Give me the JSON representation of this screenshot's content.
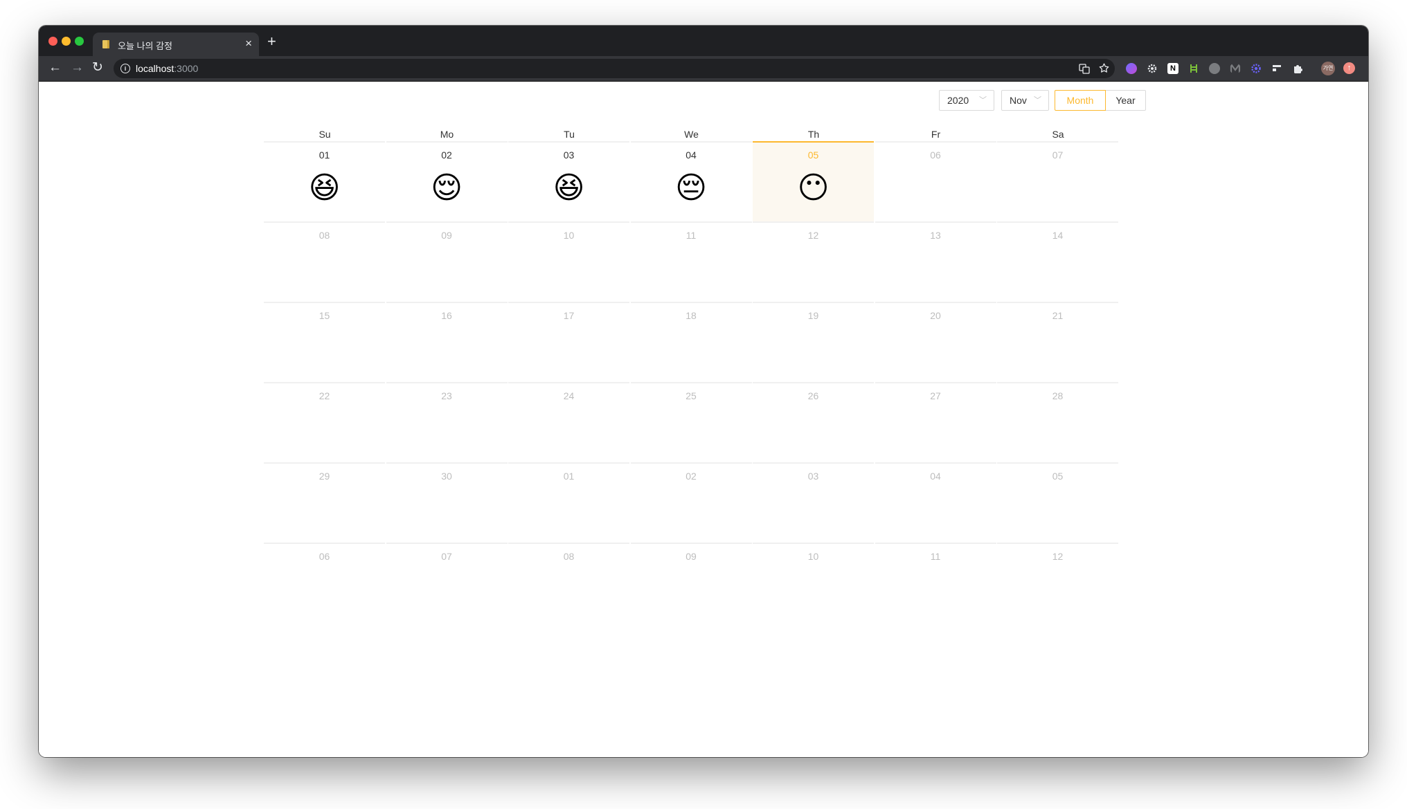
{
  "browser": {
    "tab_title": "오늘 나의 감정",
    "tab_close": "×",
    "new_tab": "+",
    "url_host": "localhost",
    "url_port": ":3000",
    "back": "←",
    "forward": "→",
    "reload": "↻",
    "avatar_text": "가연"
  },
  "controls": {
    "year": "2020",
    "month": "Nov",
    "mode_month": "Month",
    "mode_year": "Year",
    "active_mode": "Month",
    "accent_color": "#fcb82e"
  },
  "calendar": {
    "weekdays": [
      "Su",
      "Mo",
      "Tu",
      "We",
      "Th",
      "Fr",
      "Sa"
    ],
    "weeks": [
      [
        {
          "date": "01",
          "emoji": "😆",
          "in_past": true
        },
        {
          "date": "02",
          "emoji": "😌",
          "in_past": true
        },
        {
          "date": "03",
          "emoji": "😆",
          "in_past": true
        },
        {
          "date": "04",
          "emoji": "😔",
          "in_past": true
        },
        {
          "date": "05",
          "emoji": "😶",
          "today": true
        },
        {
          "date": "06"
        },
        {
          "date": "07"
        }
      ],
      [
        {
          "date": "08"
        },
        {
          "date": "09"
        },
        {
          "date": "10"
        },
        {
          "date": "11"
        },
        {
          "date": "12"
        },
        {
          "date": "13"
        },
        {
          "date": "14"
        }
      ],
      [
        {
          "date": "15"
        },
        {
          "date": "16"
        },
        {
          "date": "17"
        },
        {
          "date": "18"
        },
        {
          "date": "19"
        },
        {
          "date": "20"
        },
        {
          "date": "21"
        }
      ],
      [
        {
          "date": "22"
        },
        {
          "date": "23"
        },
        {
          "date": "24"
        },
        {
          "date": "25"
        },
        {
          "date": "26"
        },
        {
          "date": "27"
        },
        {
          "date": "28"
        }
      ],
      [
        {
          "date": "29"
        },
        {
          "date": "30"
        },
        {
          "date": "01"
        },
        {
          "date": "02"
        },
        {
          "date": "03"
        },
        {
          "date": "04"
        },
        {
          "date": "05"
        }
      ],
      [
        {
          "date": "06"
        },
        {
          "date": "07"
        },
        {
          "date": "08"
        },
        {
          "date": "09"
        },
        {
          "date": "10"
        },
        {
          "date": "11"
        },
        {
          "date": "12"
        }
      ]
    ]
  },
  "icons": {
    "extensions": [
      "translate-icon",
      "bookmark-star-icon",
      "purple-extension-icon",
      "gear-extension-icon",
      "notion-icon",
      "green-extension-icon",
      "grey-extension-icon",
      "monitor-extension-icon",
      "blue-gear-extension-icon",
      "window-extension-icon",
      "puzzle-icon"
    ]
  }
}
